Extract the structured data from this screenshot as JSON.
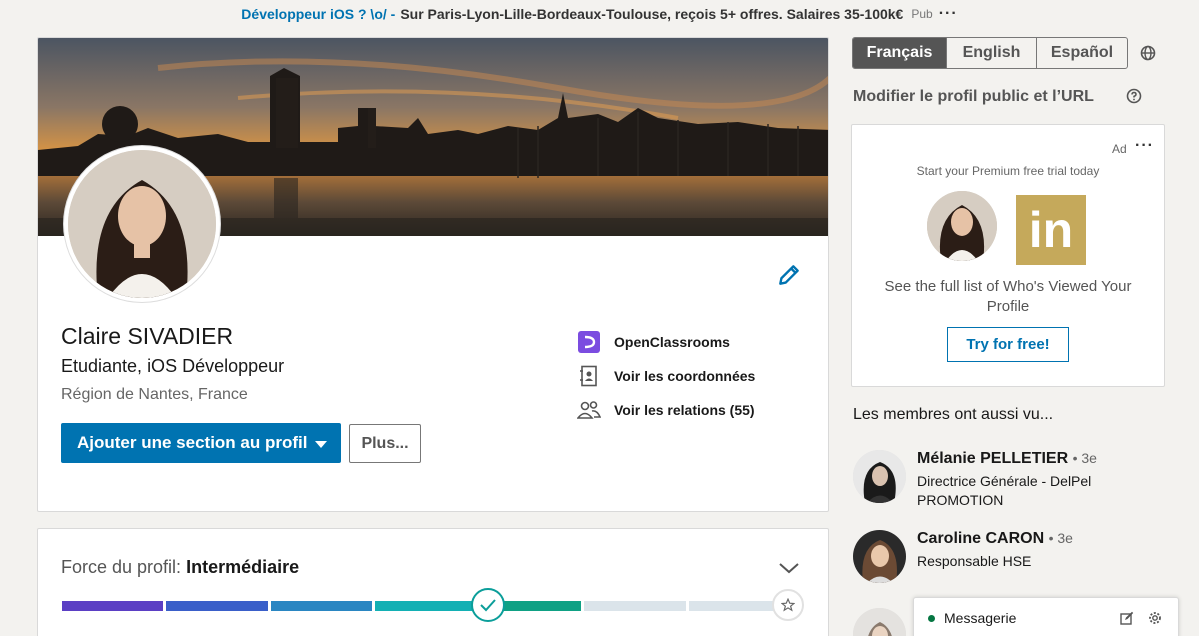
{
  "top_ad": {
    "link": "Développeur iOS ? \\o/ -",
    "text": "Sur Paris-Lyon-Lille-Bordeaux-Toulouse, reçois 5+ offres. Salaires 35-100k€",
    "label": "Pub",
    "more": "···"
  },
  "profile": {
    "name": "Claire SIVADIER",
    "headline": "Etudiante, iOS Développeur",
    "location": "Région de Nantes, France",
    "add_section_label": "Ajouter une section au profil",
    "more_label": "Plus...",
    "side_links": {
      "school": "OpenClassrooms",
      "contact": "Voir les coordonnées",
      "connections": "Voir les relations (55)"
    }
  },
  "strength": {
    "label": "Force du profil:",
    "level": "Intermédiaire",
    "progress_fraction": 0.67,
    "segment_colors": [
      "#5b3fc4",
      "#3a5fc9",
      "#2a86c2",
      "#13b0b4",
      "#0fa184",
      "#dbe4ea",
      "#dbe4ea"
    ]
  },
  "right": {
    "languages": [
      {
        "label": "Français",
        "active": true
      },
      {
        "label": "English",
        "active": false
      },
      {
        "label": "Español",
        "active": false
      }
    ],
    "edit_public_profile": "Modifier le profil public et l’URL",
    "ad": {
      "label": "Ad",
      "more": "···",
      "tagline": "Start your Premium free trial today",
      "description": "See the full list of Who's Viewed Your Profile",
      "cta": "Try for free!",
      "logo_text": "in"
    },
    "also_viewed_title": "Les membres ont aussi vu...",
    "people": [
      {
        "name": "Mélanie PELLETIER",
        "degree": "• 3e",
        "title": "Directrice Générale - DelPel PROMOTION"
      },
      {
        "name": "Caroline CARON",
        "degree": "• 3e",
        "title": "Responsable HSE"
      }
    ]
  },
  "messaging": {
    "label": "Messagerie"
  },
  "colors": {
    "brand_blue": "#0073b1",
    "open_classrooms": "#7b4ce0",
    "linkedin_gold": "#c5a95b",
    "online_green": "#057642"
  }
}
